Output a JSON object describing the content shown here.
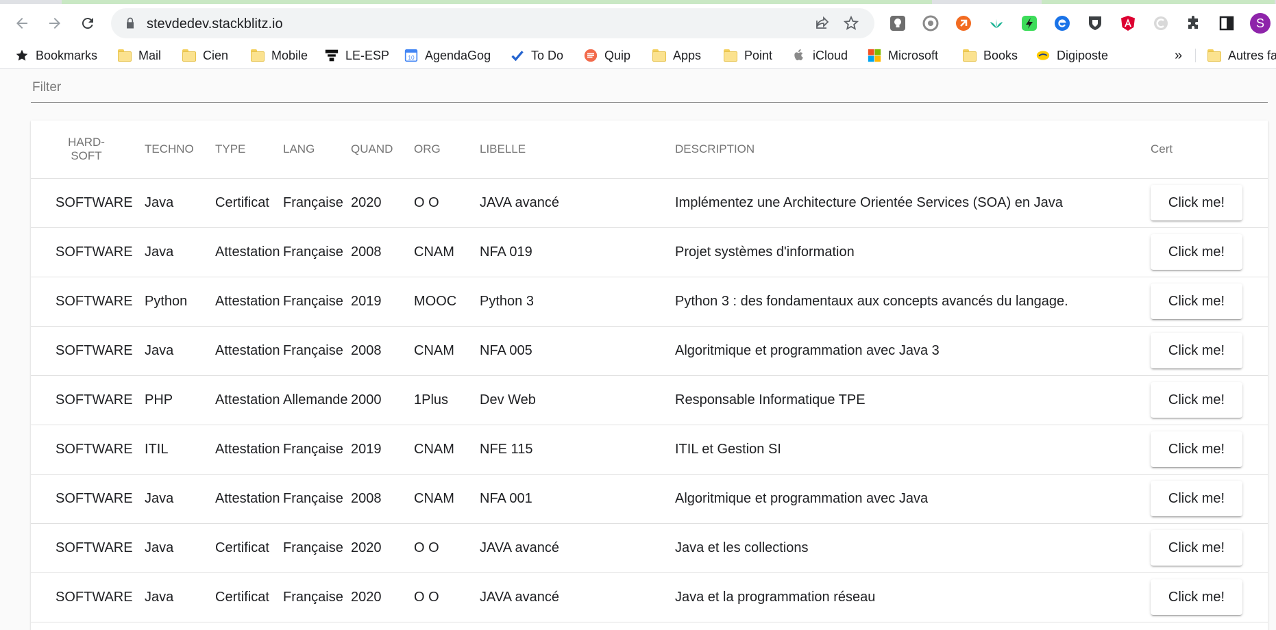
{
  "browser": {
    "url": "stevdedev.stackblitz.io",
    "avatar_letter": "S",
    "bookmarks": [
      {
        "label": "Bookmarks",
        "icon": "star-icon"
      },
      {
        "label": "Mail",
        "icon": "folder-icon"
      },
      {
        "label": "Cien",
        "icon": "folder-icon"
      },
      {
        "label": "Mobile",
        "icon": "folder-icon"
      },
      {
        "label": "LE-ESP",
        "icon": "le-esp-logo-icon"
      },
      {
        "label": "AgendaGog",
        "icon": "calendar-icon"
      },
      {
        "label": "To Do",
        "icon": "check-icon"
      },
      {
        "label": "Quip",
        "icon": "quip-icon"
      },
      {
        "label": "Apps",
        "icon": "folder-icon"
      },
      {
        "label": "Point",
        "icon": "folder-icon"
      },
      {
        "label": "iCloud",
        "icon": "apple-icon"
      },
      {
        "label": "Microsoft",
        "icon": "microsoft-icon"
      },
      {
        "label": "Books",
        "icon": "folder-icon"
      },
      {
        "label": "Digiposte",
        "icon": "digiposte-icon"
      }
    ],
    "overflow_label": "»",
    "other_bookmarks": "Autres fa"
  },
  "filter": {
    "placeholder": "Filter"
  },
  "table": {
    "headers": {
      "hardsoft": "HARD-SOFT",
      "techno": "TECHNO",
      "type": "TYPE",
      "lang": "LANG",
      "quand": "QUAND",
      "org": "ORG",
      "libelle": "LIBELLE",
      "description": "DESCRIPTION",
      "cert": "Cert"
    },
    "button_label": "Click me!",
    "rows": [
      {
        "hardsoft": "SOFTWARE",
        "techno": "Java",
        "type": "Certificat",
        "lang": "Française",
        "quand": "2020",
        "org": "O O",
        "libelle": "JAVA avancé",
        "description": "Implémentez une Architecture Orientée Services (SOA) en Java"
      },
      {
        "hardsoft": "SOFTWARE",
        "techno": "Java",
        "type": "Attestation",
        "lang": "Française",
        "quand": "2008",
        "org": "CNAM",
        "libelle": "NFA 019",
        "description": "Projet systèmes d'information"
      },
      {
        "hardsoft": "SOFTWARE",
        "techno": "Python",
        "type": "Attestation",
        "lang": "Française",
        "quand": "2019",
        "org": "MOOC",
        "libelle": "Python 3",
        "description": "Python 3 : des fondamentaux aux concepts avancés du langage."
      },
      {
        "hardsoft": "SOFTWARE",
        "techno": "Java",
        "type": "Attestation",
        "lang": "Française",
        "quand": "2008",
        "org": "CNAM",
        "libelle": "NFA 005",
        "description": "Algoritmique et programmation avec Java 3"
      },
      {
        "hardsoft": "SOFTWARE",
        "techno": "PHP",
        "type": "Attestation",
        "lang": "Allemande",
        "quand": "2000",
        "org": "1Plus",
        "libelle": "Dev Web",
        "description": "Responsable Informatique TPE"
      },
      {
        "hardsoft": "SOFTWARE",
        "techno": "ITIL",
        "type": "Attestation",
        "lang": "Française",
        "quand": "2019",
        "org": "CNAM",
        "libelle": "NFE 115",
        "description": "ITIL et Gestion SI"
      },
      {
        "hardsoft": "SOFTWARE",
        "techno": "Java",
        "type": "Attestation",
        "lang": "Française",
        "quand": "2008",
        "org": "CNAM",
        "libelle": "NFA 001",
        "description": "Algoritmique et programmation avec Java"
      },
      {
        "hardsoft": "SOFTWARE",
        "techno": "Java",
        "type": "Certificat",
        "lang": "Française",
        "quand": "2020",
        "org": "O O",
        "libelle": "JAVA avancé",
        "description": "Java et les collections"
      },
      {
        "hardsoft": "SOFTWARE",
        "techno": "Java",
        "type": "Certificat",
        "lang": "Française",
        "quand": "2020",
        "org": "O O",
        "libelle": "JAVA avancé",
        "description": "Java et la programmation réseau"
      }
    ]
  }
}
